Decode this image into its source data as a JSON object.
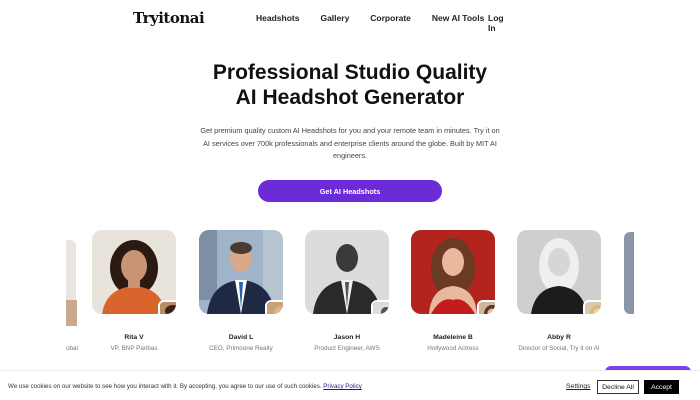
{
  "nav": {
    "logo": "Tryitonai",
    "links": [
      "Headshots",
      "Gallery",
      "Corporate",
      "New AI Tools"
    ],
    "login": "Log In"
  },
  "hero": {
    "title_line1": "Professional Studio Quality",
    "title_line2": "AI Headshot Generator",
    "subtitle": "Get premium quality custom AI Headshots for you and your remote team in minutes. Try it on AI services over 700k professionals and enterprise clients around the globe. Built by MIT AI engineers.",
    "cta": "Get AI Headshots"
  },
  "cards": [
    {
      "name": "Rita V",
      "role": "VP, BNP Paribas"
    },
    {
      "name": "David L",
      "role": "CEO, Primoone Realty"
    },
    {
      "name": "Jason H",
      "role": "Product Engineer, AWS"
    },
    {
      "name": "Madeleine B",
      "role": "Hollywood Actress"
    },
    {
      "name": "Abby R",
      "role": "Director of Social, Try it on AI"
    }
  ],
  "partial_left_role": "obal",
  "cookie": {
    "text": "We use cookies on our website to see how you interact with it. By accepting, you agree to our use of such cookies.",
    "policy_link": "Privacy Policy",
    "settings": "Settings",
    "decline": "Decline All",
    "accept": "Accept"
  },
  "colors": {
    "cta": "#6c2bd9",
    "accept_bg": "#000000"
  }
}
